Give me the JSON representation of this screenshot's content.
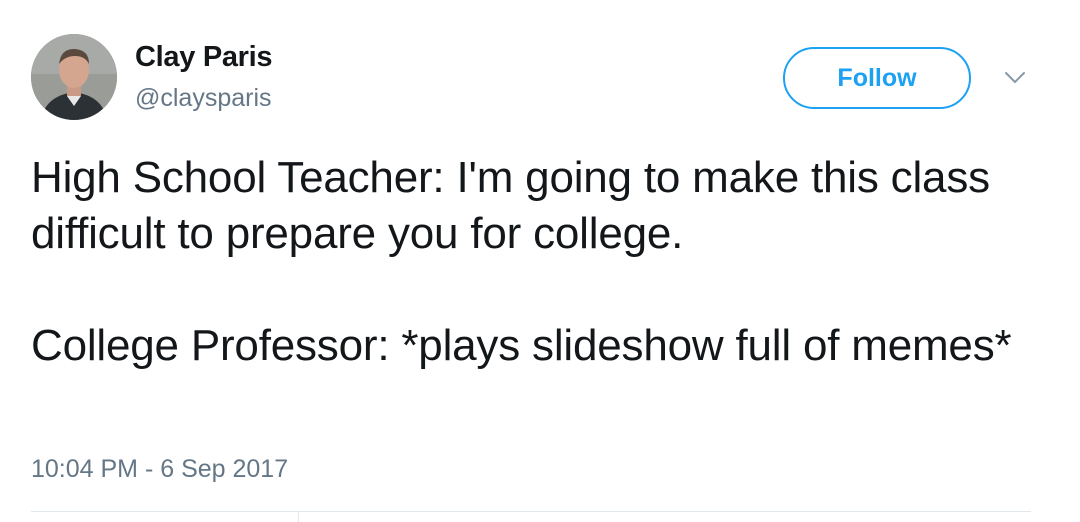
{
  "tweet": {
    "author": {
      "name": "Clay Paris",
      "handle": "@claysparis"
    },
    "follow_label": "Follow",
    "body_lines": [
      "High School Teacher: I'm going to make this class difficult to prepare you for college.",
      "College Professor: *plays slideshow full of memes*"
    ],
    "timestamp": "10:04 PM - 6 Sep 2017"
  },
  "icons": {
    "more": "chevron-down-icon",
    "avatar": "avatar"
  },
  "colors": {
    "accent": "#1da1f2",
    "text": "#14171a",
    "muted": "#657786",
    "divider": "#e1e8ed"
  }
}
